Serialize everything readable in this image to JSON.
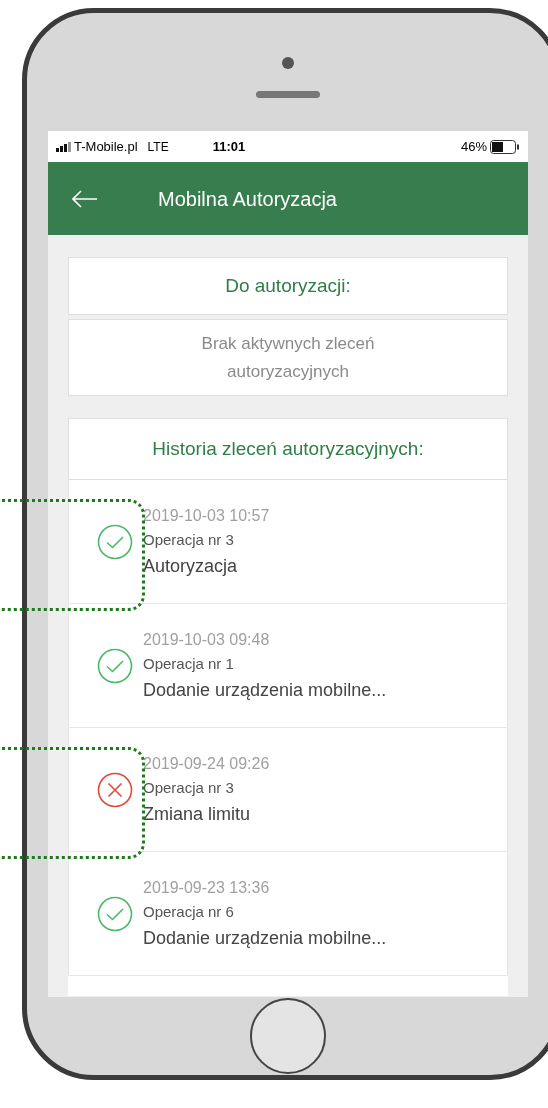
{
  "status_bar": {
    "carrier": "T-Mobile.pl",
    "network": "LTE",
    "time": "11:01",
    "battery": "46%"
  },
  "header": {
    "title": "Mobilna Autoryzacja"
  },
  "pending": {
    "title": "Do autoryzacji:",
    "message": "Brak aktywnych zleceń autoryzacyjnych"
  },
  "history": {
    "title": "Historia zleceń autoryzacyjnych:",
    "items": [
      {
        "kind": "success",
        "date": "2019-10-03 10:57",
        "operation": "Operacja nr 3",
        "description": "Autoryzacja",
        "highlighted": true
      },
      {
        "kind": "success",
        "date": "2019-10-03 09:48",
        "operation": "Operacja nr 1",
        "description": "Dodanie urządzenia mobilne...",
        "highlighted": false
      },
      {
        "kind": "rejected",
        "date": "2019-09-24 09:26",
        "operation": "Operacja nr 3",
        "description": "Zmiana limitu",
        "highlighted": true
      },
      {
        "kind": "success",
        "date": "2019-09-23 13:36",
        "operation": "Operacja nr 6",
        "description": "Dodanie urządzenia mobilne...",
        "highlighted": false
      }
    ]
  }
}
